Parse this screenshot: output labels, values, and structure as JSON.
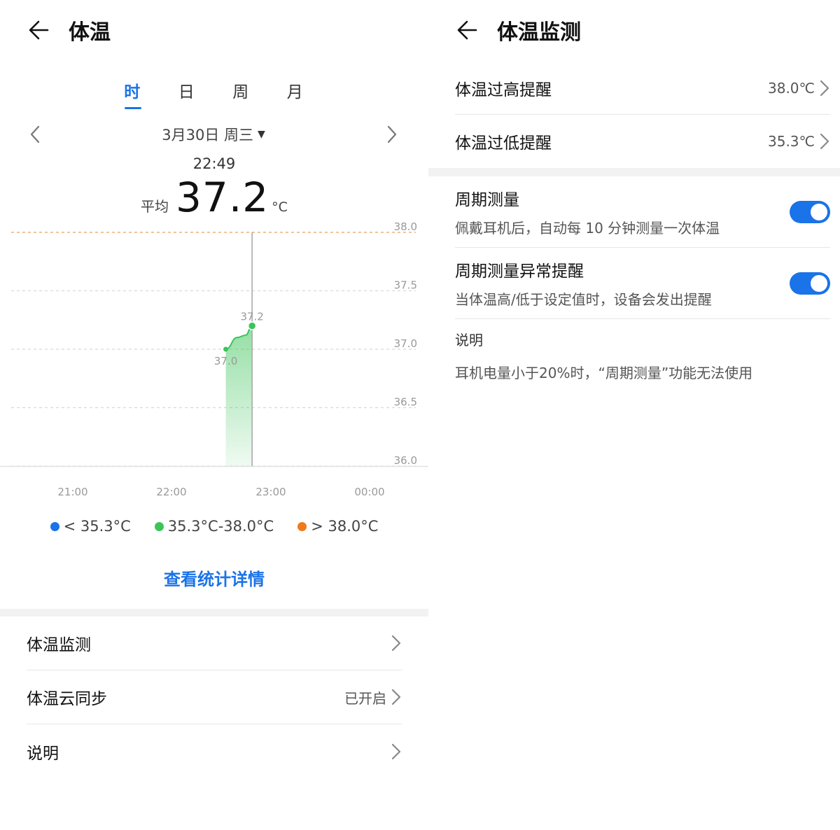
{
  "left": {
    "header": {
      "title": "体温"
    },
    "tabs": [
      {
        "label": "时",
        "active": true
      },
      {
        "label": "日",
        "active": false
      },
      {
        "label": "周",
        "active": false
      },
      {
        "label": "月",
        "active": false
      }
    ],
    "date": {
      "label": "3月30日 周三",
      "caret": "▼"
    },
    "time": "22:49",
    "average": {
      "label": "平均",
      "value": "37.2",
      "unit": "°C"
    },
    "legend": [
      {
        "label": "< 35.3°C",
        "color": "#1a73e8"
      },
      {
        "label": "35.3°C-38.0°C",
        "color": "#3cc45a"
      },
      {
        "label": "> 38.0°C",
        "color": "#f07a1a"
      }
    ],
    "stats_link": "查看统计详情",
    "menu": [
      {
        "label": "体温监测",
        "value": ""
      },
      {
        "label": "体温云同步",
        "value": "已开启"
      },
      {
        "label": "说明",
        "value": ""
      }
    ]
  },
  "chart_data": {
    "type": "area",
    "x_tick_labels": [
      "21:00",
      "22:00",
      "23:00",
      "00:00"
    ],
    "y_tick_labels": [
      "38.0",
      "37.5",
      "37.0",
      "36.5",
      "36.0"
    ],
    "ylim": [
      36.0,
      38.0
    ],
    "threshold_line": 38.0,
    "series": [
      {
        "x": [
          "22:33",
          "22:40",
          "22:45",
          "22:49"
        ],
        "values": [
          37.0,
          37.1,
          37.12,
          37.2
        ]
      }
    ],
    "point_labels": [
      {
        "x": "22:33",
        "value": 37.0,
        "label": "37.0"
      },
      {
        "x": "22:49",
        "value": 37.2,
        "label": "37.2"
      }
    ],
    "cursor_x": "22:49",
    "colors": {
      "line": "#3cc45a",
      "threshold": "#e8a060",
      "grid": "#d8d8d8"
    }
  },
  "right": {
    "header": {
      "title": "体温监测"
    },
    "thresholds": [
      {
        "label": "体温过高提醒",
        "value": "38.0℃"
      },
      {
        "label": "体温过低提醒",
        "value": "35.3℃"
      }
    ],
    "switches": [
      {
        "title": "周期测量",
        "sub": "佩戴耳机后，自动每 10 分钟测量一次体温",
        "on": true
      },
      {
        "title": "周期测量异常提醒",
        "sub": "当体温高/低于设定值时，设备会发出提醒",
        "on": true
      }
    ],
    "note": {
      "title": "说明",
      "body": "耳机电量小于20%时，“周期测量”功能无法使用"
    }
  }
}
